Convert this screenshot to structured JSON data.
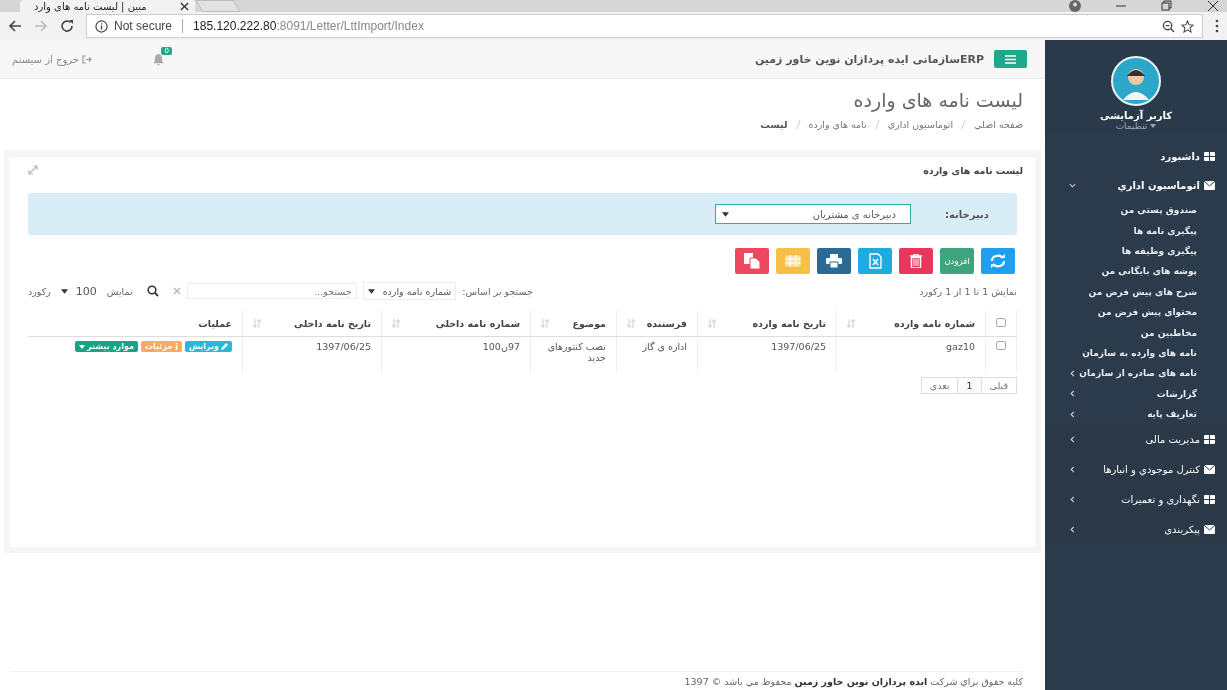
{
  "browser": {
    "tab_title": "مبین | لیست نامه های وارد",
    "security": "Not secure",
    "url_host": "185.120.222.80",
    "url_path": ":8091/Letter/LttImport/Index"
  },
  "header": {
    "title": "ERPسازمانی ایده پردازان نوین خاور زمین",
    "notifications": "0",
    "logout": "خروج از سیستم"
  },
  "user": {
    "name": "کاربر آزمایشی",
    "settings": "تنظیمات"
  },
  "sidebar": {
    "items": [
      {
        "label": "داشبورد"
      },
      {
        "label": "اتوماسیون اداري",
        "expanded": true,
        "children": [
          {
            "label": "صندوق پستی من"
          },
          {
            "label": "پیگیری نامه ها"
          },
          {
            "label": "پیگیری وظیفه ها"
          },
          {
            "label": "پوشه های بایگانی من"
          },
          {
            "label": "شرح های پیش فرض من"
          },
          {
            "label": "محتوای پیش فرض من"
          },
          {
            "label": "مخاطبین من"
          },
          {
            "label": "نامه های وارده به سازمان"
          },
          {
            "label": "نامه های صادره از سازمان",
            "expanded": false
          },
          {
            "label": "گزارشات",
            "expanded": false
          },
          {
            "label": "تعاریف پایه",
            "expanded": false
          }
        ]
      },
      {
        "label": "مدیریت مالی",
        "expanded": false
      },
      {
        "label": "کنترل موجودي و انبارها",
        "expanded": false
      },
      {
        "label": "نگهداری و تعمیرات",
        "expanded": false
      },
      {
        "label": "پیکربندی",
        "expanded": false
      }
    ]
  },
  "page_title": "لیست نامه های وارده",
  "breadcrumb": [
    {
      "label": "صفحه اصلي",
      "selected": false
    },
    {
      "label": "اتوماسیون اداري",
      "selected": false
    },
    {
      "label": "نامه های وارده",
      "selected": false
    },
    {
      "label": "لیست",
      "selected": true
    }
  ],
  "panel": {
    "title": "لیست نامه های وارده",
    "filter": {
      "label": "دبیرخانه:",
      "value": "دبیرخانه ی مشتریان"
    },
    "toolbar": [
      {
        "kind": "refresh",
        "color": "#1e9ff2"
      },
      {
        "kind": "add",
        "label": "افزودن",
        "color": "#3fa47e"
      },
      {
        "kind": "delete",
        "color": "#e8365d"
      },
      {
        "kind": "excel",
        "color": "#1eabe0"
      },
      {
        "kind": "print",
        "color": "#2b6a94"
      },
      {
        "kind": "columns",
        "color": "#f5c045"
      },
      {
        "kind": "copy",
        "color": "#ee4860"
      }
    ],
    "info": "نمایش 1 تا 1 از 1 رکورد",
    "search_by_label": "جستجو بر اساس:",
    "search_by": "شماره نامه وارده",
    "search": {
      "placeholder": "جستجو..."
    },
    "show_label": "نمایش",
    "page_size": "100",
    "records_label": "رکورد",
    "table": {
      "all_checked": false,
      "columns": [
        "شماره نامه وارده",
        "تاریخ نامه وارده",
        "فرستنده",
        "موضوع",
        "شماره نامه داخلی",
        "تاریخ نامه داخلی",
        "عملیات"
      ],
      "rows": [
        {
          "checked": false,
          "cells": [
            "gaz10",
            "1397/06/25",
            "اداره ی گاز",
            "نصب کنتورهای جدید",
            "97ن100",
            "1397/06/25"
          ],
          "actions": [
            {
              "kind": "edit",
              "label": "ویرایش"
            },
            {
              "kind": "details",
              "label": "جزئیات"
            },
            {
              "kind": "more",
              "label": "موارد بیشتر"
            }
          ]
        }
      ]
    },
    "pagination": [
      {
        "label": "قبلی",
        "selected": false
      },
      {
        "label": "1",
        "selected": true
      },
      {
        "label": "بعدی",
        "selected": false
      }
    ]
  },
  "footer": "کلیه حقوق براي شركت **ایده پردازان نوین خاور زمین** محفوظ مي باشد © 1397"
}
